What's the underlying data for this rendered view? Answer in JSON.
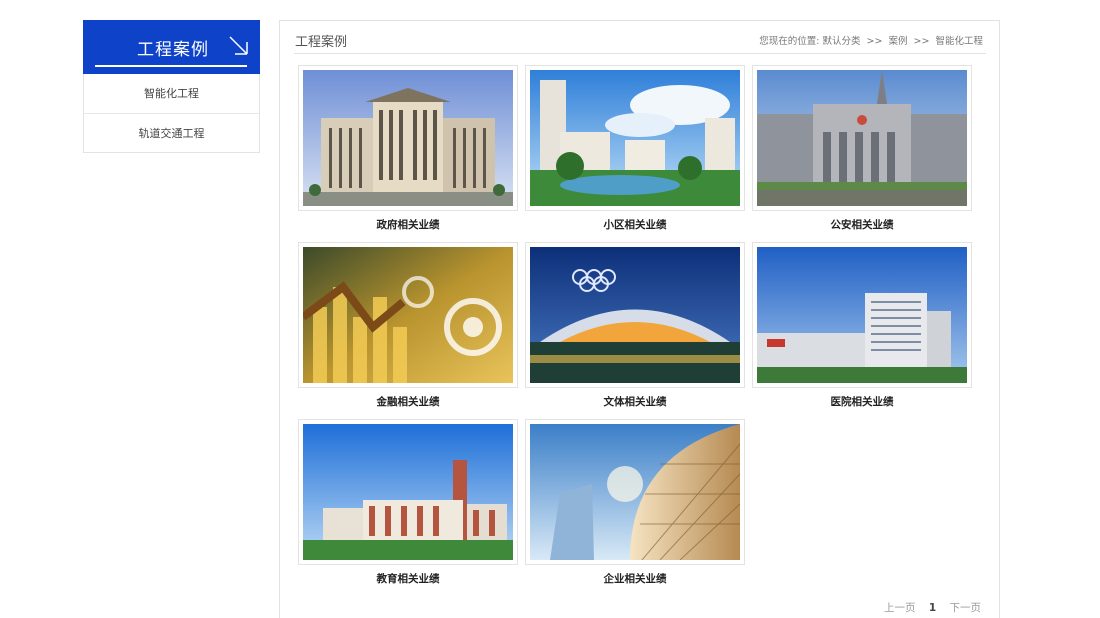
{
  "sidebar": {
    "title": "工程案例",
    "items": [
      {
        "label": "智能化工程"
      },
      {
        "label": "轨道交通工程"
      }
    ]
  },
  "main": {
    "title": "工程案例",
    "breadcrumb": {
      "prefix": "您现在的位置:",
      "links": [
        "默认分类",
        "案例",
        "智能化工程"
      ],
      "separator": ">>"
    }
  },
  "cases": [
    {
      "caption": "政府相关业绩",
      "image": "government-building-photo"
    },
    {
      "caption": "小区相关业绩",
      "image": "residential-community-photo"
    },
    {
      "caption": "公安相关业绩",
      "image": "police-building-photo"
    },
    {
      "caption": "金融相关业绩",
      "image": "finance-chart-photo"
    },
    {
      "caption": "文体相关业绩",
      "image": "stadium-photo"
    },
    {
      "caption": "医院相关业绩",
      "image": "hospital-building-photo"
    },
    {
      "caption": "教育相关业绩",
      "image": "school-building-photo"
    },
    {
      "caption": "企业相关业绩",
      "image": "corporate-tower-photo"
    }
  ],
  "pagination": {
    "prev": "上一页",
    "current": "1",
    "next": "下一页"
  },
  "colors": {
    "accent": "#0e43c9"
  }
}
